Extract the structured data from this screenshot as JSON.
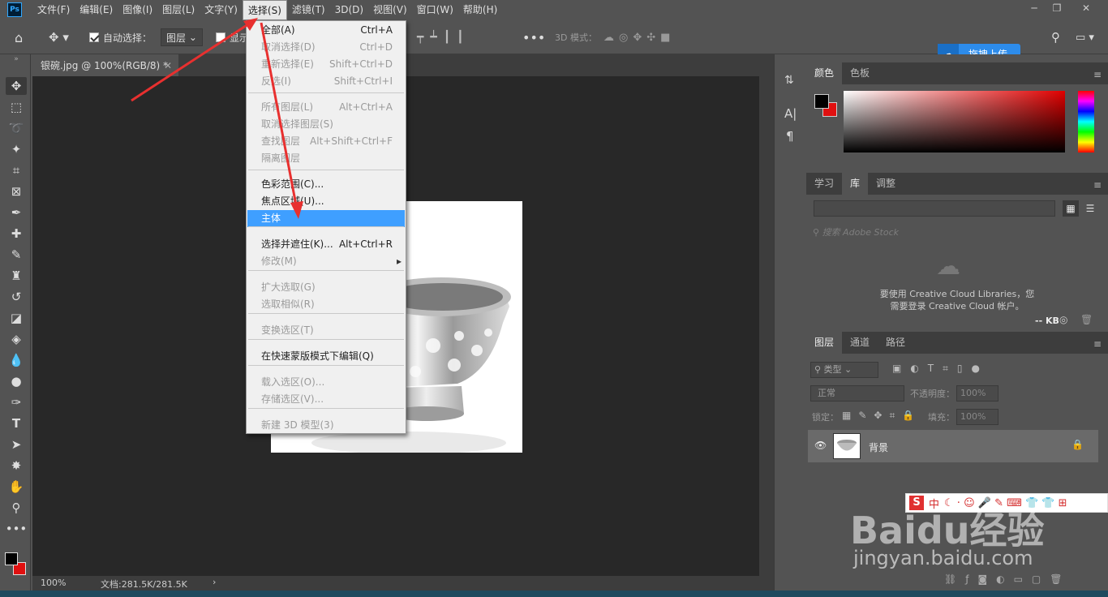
{
  "menubar": {
    "logo": "Ps",
    "items": [
      "文件(F)",
      "编辑(E)",
      "图像(I)",
      "图层(L)",
      "文字(Y)",
      "选择(S)",
      "滤镜(T)",
      "3D(D)",
      "视图(V)",
      "窗口(W)",
      "帮助(H)"
    ],
    "active_index": 5
  },
  "options": {
    "auto_select_label": "自动选择：",
    "auto_select_value": "图层",
    "show_transform": "显示",
    "mode_3d_label": "3D 模式：",
    "upload_label": "拖拽上传"
  },
  "document": {
    "tab_title": "银碗.jpg @ 100%(RGB/8) *",
    "zoom": "100%",
    "doc_info": "文档:281.5K/281.5K"
  },
  "select_menu": {
    "items": [
      {
        "label": "全部(A)",
        "shortcut": "Ctrl+A",
        "disabled": false
      },
      {
        "label": "取消选择(D)",
        "shortcut": "Ctrl+D",
        "disabled": true
      },
      {
        "label": "重新选择(E)",
        "shortcut": "Shift+Ctrl+D",
        "disabled": true
      },
      {
        "label": "反选(I)",
        "shortcut": "Shift+Ctrl+I",
        "disabled": true
      },
      {
        "label": "所有图层(L)",
        "shortcut": "Alt+Ctrl+A",
        "disabled": true
      },
      {
        "label": "取消选择图层(S)",
        "shortcut": "",
        "disabled": true
      },
      {
        "label": "查找图层",
        "shortcut": "Alt+Shift+Ctrl+F",
        "disabled": true
      },
      {
        "label": "隔离图层",
        "shortcut": "",
        "disabled": true
      },
      {
        "label": "色彩范围(C)...",
        "shortcut": "",
        "disabled": false
      },
      {
        "label": "焦点区域(U)...",
        "shortcut": "",
        "disabled": false
      },
      {
        "label": "主体",
        "shortcut": "",
        "disabled": false,
        "highlighted": true
      },
      {
        "label": "选择并遮住(K)...",
        "shortcut": "Alt+Ctrl+R",
        "disabled": false
      },
      {
        "label": "修改(M)",
        "shortcut": "",
        "disabled": true,
        "submenu": true
      },
      {
        "label": "扩大选取(G)",
        "shortcut": "",
        "disabled": true
      },
      {
        "label": "选取相似(R)",
        "shortcut": "",
        "disabled": true
      },
      {
        "label": "变换选区(T)",
        "shortcut": "",
        "disabled": true
      },
      {
        "label": "在快速蒙版模式下编辑(Q)",
        "shortcut": "",
        "disabled": false
      },
      {
        "label": "载入选区(O)...",
        "shortcut": "",
        "disabled": true
      },
      {
        "label": "存储选区(V)...",
        "shortcut": "",
        "disabled": true
      },
      {
        "label": "新建 3D 模型(3)",
        "shortcut": "",
        "disabled": true
      }
    ]
  },
  "color_panel": {
    "tabs": [
      "颜色",
      "色板"
    ],
    "fg_color": "#000000",
    "bg_color": "#e01010"
  },
  "library_panel": {
    "tabs": [
      "学习",
      "库",
      "调整"
    ],
    "search_placeholder": "搜索 Adobe Stock",
    "message_line1": "要使用 Creative Cloud Libraries，您",
    "message_line2": "需要登录 Creative Cloud 帐户。",
    "size": "-- KB"
  },
  "layers_panel": {
    "tabs": [
      "图层",
      "通道",
      "路径"
    ],
    "filter_label": "类型",
    "blend_mode": "正常",
    "opacity_label": "不透明度：",
    "opacity_value": "100%",
    "lock_label": "锁定：",
    "fill_label": "填充：",
    "fill_value": "100%",
    "layer_name": "背景"
  },
  "watermark": {
    "brand": "Baidu经验",
    "url": "jingyan.baidu.com"
  },
  "ime": {
    "lang": "中"
  }
}
